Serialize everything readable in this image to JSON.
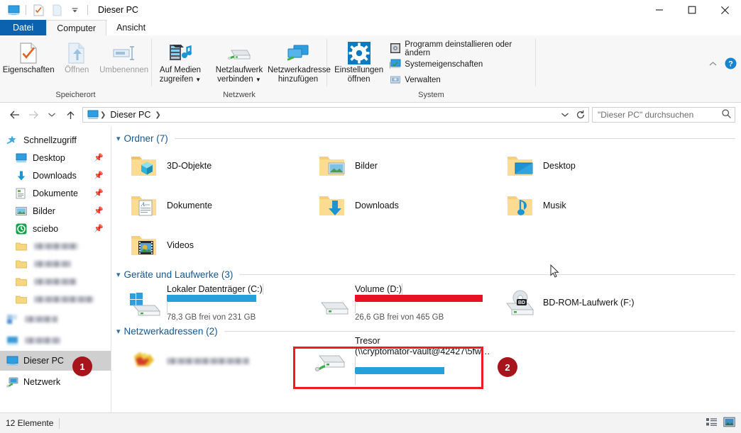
{
  "window": {
    "title": "Dieser PC",
    "quick_access_icons": [
      "this-pc-icon",
      "properties-icon",
      "new-folder-icon",
      "customize-chevron-icon"
    ],
    "controls": {
      "minimize": "minimize-icon",
      "maximize": "maximize-icon",
      "close": "close-icon"
    }
  },
  "ribbon": {
    "tabs": [
      {
        "label": "Datei",
        "state": "file"
      },
      {
        "label": "Computer",
        "state": "active"
      },
      {
        "label": "Ansicht",
        "state": "normal"
      }
    ],
    "groups": [
      {
        "label": "Speicherort",
        "buttons": [
          {
            "label": "Eigenschaften",
            "icon": "properties-icon",
            "disabled": false
          },
          {
            "label": "Öffnen",
            "icon": "open-icon",
            "disabled": true
          },
          {
            "label": "Umbenennen",
            "icon": "rename-icon",
            "disabled": true
          }
        ]
      },
      {
        "label": "Netzwerk",
        "buttons": [
          {
            "label": "Auf Medien zugreifen",
            "icon": "media-server-icon",
            "caret": true
          },
          {
            "label": "Netzlaufwerk verbinden",
            "icon": "map-network-drive-icon",
            "caret": true
          },
          {
            "label": "Netzwerkadresse hinzufügen",
            "icon": "add-network-location-icon",
            "caret": false
          }
        ]
      },
      {
        "label": "System",
        "big_button": {
          "label_line1": "Einstellungen",
          "label_line2": "öffnen",
          "icon": "settings-gear-icon"
        },
        "small_buttons": [
          {
            "label": "Programm deinstallieren oder ändern",
            "icon": "uninstall-program-icon"
          },
          {
            "label": "Systemeigenschaften",
            "icon": "system-properties-icon"
          },
          {
            "label": "Verwalten",
            "icon": "manage-computer-icon"
          }
        ]
      }
    ],
    "collapse_icon": "chevron-up-icon",
    "help_icon": "help-icon"
  },
  "address": {
    "back_icon": "back-arrow-icon",
    "forward_icon": "forward-arrow-icon",
    "recent_icon": "recent-locations-icon",
    "up_icon": "up-arrow-icon",
    "root_icon": "this-pc-icon",
    "crumb": "Dieser PC",
    "dropdown_icon": "chevron-down-icon",
    "refresh_icon": "refresh-icon",
    "search_placeholder": "\"Dieser PC\" durchsuchen",
    "search_value": "",
    "search_icon": "search-icon"
  },
  "navpane": {
    "items": [
      {
        "label": "Schnellzugriff",
        "icon": "quick-access-star-icon",
        "indent": false,
        "pinned": false,
        "redacted": false,
        "selected": false
      },
      {
        "label": "Desktop",
        "icon": "desktop-icon",
        "indent": true,
        "pinned": true,
        "redacted": false,
        "selected": false
      },
      {
        "label": "Downloads",
        "icon": "downloads-arrow-icon",
        "indent": true,
        "pinned": true,
        "redacted": false,
        "selected": false
      },
      {
        "label": "Dokumente",
        "icon": "documents-icon",
        "indent": true,
        "pinned": true,
        "redacted": false,
        "selected": false
      },
      {
        "label": "Bilder",
        "icon": "pictures-icon",
        "indent": true,
        "pinned": true,
        "redacted": false,
        "selected": false
      },
      {
        "label": "sciebo",
        "icon": "sciebo-cloud-icon",
        "indent": true,
        "pinned": true,
        "redacted": false,
        "selected": false
      },
      {
        "label": "",
        "icon": "folder-icon",
        "indent": true,
        "pinned": false,
        "redacted": true,
        "selected": false,
        "blur_width": 62
      },
      {
        "label": "",
        "icon": "folder-icon",
        "indent": true,
        "pinned": false,
        "redacted": true,
        "selected": false,
        "blur_width": 52
      },
      {
        "label": "",
        "icon": "folder-icon",
        "indent": true,
        "pinned": false,
        "redacted": true,
        "selected": false,
        "blur_width": 60
      },
      {
        "label": "",
        "icon": "folder-icon",
        "indent": true,
        "pinned": false,
        "redacted": true,
        "selected": false,
        "blur_width": 84
      },
      {
        "label": "",
        "icon": "onedrive-icon",
        "indent": false,
        "pinned": false,
        "redacted": true,
        "selected": false,
        "blur_width": 46
      },
      {
        "label": "",
        "icon": "this-pc-icon",
        "indent": false,
        "pinned": false,
        "redacted": true,
        "selected": false,
        "blur_width": 50
      },
      {
        "label": "Dieser PC",
        "icon": "this-pc-icon",
        "indent": false,
        "pinned": false,
        "redacted": false,
        "selected": true
      },
      {
        "label": "Netzwerk",
        "icon": "network-icon",
        "indent": false,
        "pinned": false,
        "redacted": false,
        "selected": false
      }
    ]
  },
  "content": {
    "groups": [
      {
        "title": "Ordner (7)"
      },
      {
        "title": "Geräte und Laufwerke (3)"
      },
      {
        "title": "Netzwerkadressen (2)"
      }
    ],
    "folders": [
      {
        "name": "3D-Objekte",
        "icon": "folder-3d-objects-icon"
      },
      {
        "name": "Bilder",
        "icon": "folder-pictures-icon"
      },
      {
        "name": "Desktop",
        "icon": "folder-desktop-icon"
      },
      {
        "name": "Dokumente",
        "icon": "folder-documents-icon"
      },
      {
        "name": "Downloads",
        "icon": "folder-downloads-icon"
      },
      {
        "name": "Musik",
        "icon": "folder-music-icon"
      },
      {
        "name": "Videos",
        "icon": "folder-videos-icon"
      }
    ],
    "drives": [
      {
        "name": "Lokaler Datenträger (C:)",
        "icon": "windows-drive-icon",
        "has_bar": true,
        "fill_percent": 66,
        "fill_color": "#26a0da",
        "free_text": "78,3 GB frei von 231 GB"
      },
      {
        "name": "Volume (D:)",
        "icon": "hard-drive-icon",
        "has_bar": true,
        "fill_percent": 94,
        "fill_color": "#e81123",
        "free_text": "26,6 GB frei von 465 GB"
      },
      {
        "name": "BD-ROM-Laufwerk (F:)",
        "icon": "bd-rom-drive-icon",
        "has_bar": false,
        "fill_percent": 0,
        "fill_color": "",
        "free_text": ""
      }
    ],
    "network_locations": [
      {
        "name": "",
        "path": "",
        "icon": "network-location-redacted-icon",
        "redacted": true,
        "has_bar": false,
        "fill_percent": 0,
        "fill_color": ""
      },
      {
        "name": "Tresor",
        "path": "(\\\\cryptomator-vault@42427\\5fw…",
        "icon": "network-drive-icon",
        "redacted": false,
        "has_bar": true,
        "fill_percent": 66,
        "fill_color": "#26a0da"
      }
    ]
  },
  "annotations": {
    "highlight_color": "#ee1c20",
    "badge_color": "#a8141c",
    "badges": [
      {
        "label": "1",
        "target": "navpane-dieser-pc"
      },
      {
        "label": "2",
        "target": "tresor-network-drive"
      }
    ]
  },
  "statusbar": {
    "item_count": "12 Elemente",
    "view_details_icon": "details-view-icon",
    "view_tiles_icon": "large-icons-view-icon"
  }
}
